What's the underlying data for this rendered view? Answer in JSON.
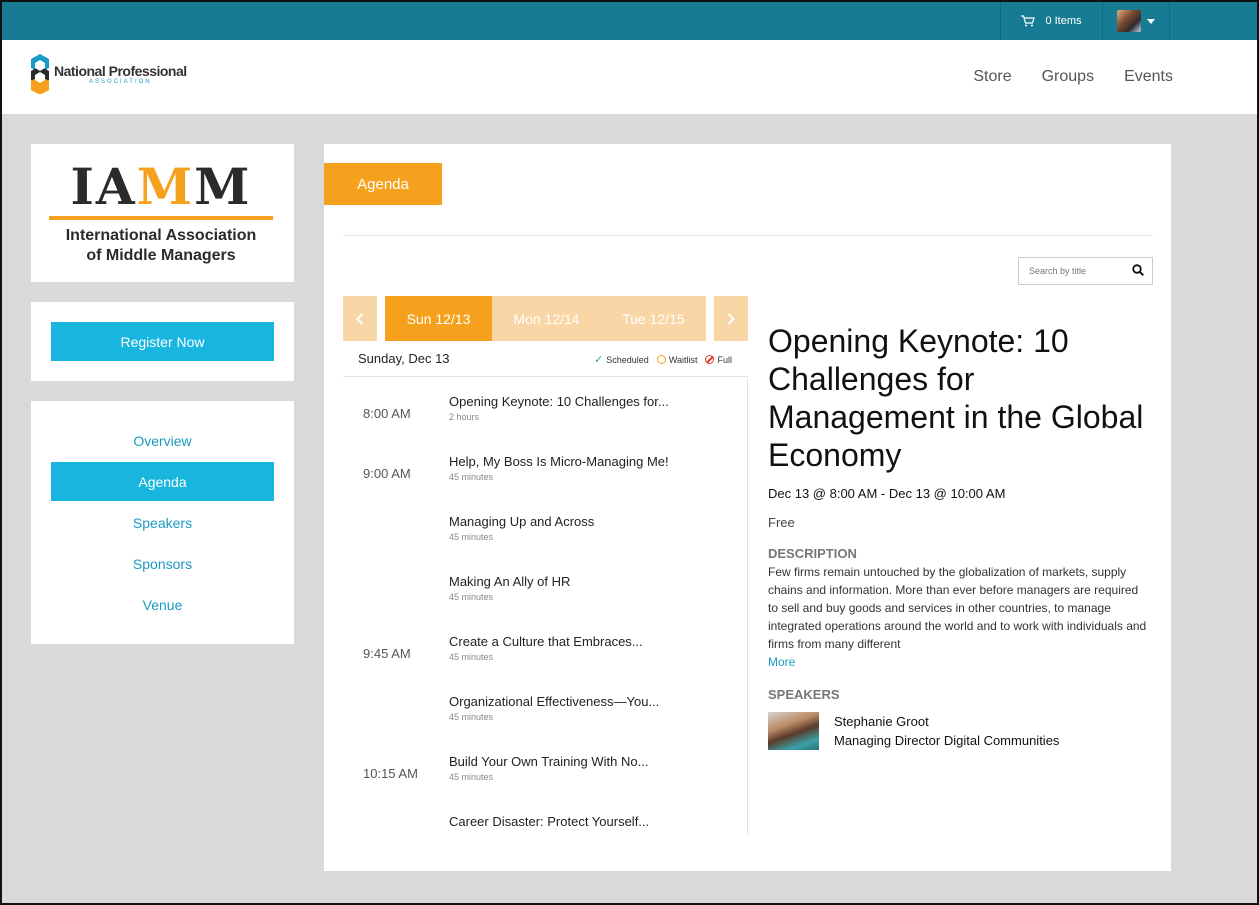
{
  "topbar": {
    "cart_label": "0 Items"
  },
  "header": {
    "brand_title": "National Professional",
    "brand_sub": "ASSOCIATION",
    "nav": [
      "Store",
      "Groups",
      "Events"
    ]
  },
  "org": {
    "acronym_1": "IA",
    "acronym_2": "M",
    "acronym_3": "M",
    "name_line1": "International Association",
    "name_line2": "of Middle Managers"
  },
  "sidebar": {
    "register_label": "Register Now",
    "menu": [
      "Overview",
      "Agenda",
      "Speakers",
      "Sponsors",
      "Venue"
    ]
  },
  "main": {
    "tab_label": "Agenda",
    "search_placeholder": "Search by title",
    "days": [
      "Sun 12/13",
      "Mon 12/14",
      "Tue 12/15"
    ],
    "day_title": "Sunday, Dec 13",
    "legend": {
      "scheduled": "Scheduled",
      "waitlist": "Waitlist",
      "full": "Full"
    },
    "sessions": [
      {
        "time": "8:00 AM",
        "title": "Opening Keynote: 10 Challenges for...",
        "duration": "2 hours"
      },
      {
        "time": "9:00 AM",
        "title": "Help, My Boss Is Micro-Managing Me!",
        "duration": "45 minutes"
      },
      {
        "time": "",
        "title": "Managing Up and Across",
        "duration": "45 minutes"
      },
      {
        "time": "",
        "title": "Making An Ally of HR",
        "duration": "45 minutes"
      },
      {
        "time": "9:45 AM",
        "title": "Create a Culture that Embraces...",
        "duration": "45 minutes"
      },
      {
        "time": "",
        "title": "Organizational Effectiveness—You...",
        "duration": "45 minutes"
      },
      {
        "time": "10:15 AM",
        "title": "Build Your Own Training With No...",
        "duration": "45 minutes"
      },
      {
        "time": "",
        "title": "Career Disaster: Protect Yourself...",
        "duration": ""
      }
    ]
  },
  "detail": {
    "title": "Opening Keynote: 10 Challenges for Management in the Global Economy",
    "when": "Dec 13 @ 8:00 AM - Dec 13 @ 10:00 AM",
    "price": "Free",
    "description_label": "DESCRIPTION",
    "description": "Few firms remain untouched by the globalization of markets, supply chains and information. More than ever before managers are required to sell and buy goods and services in other countries, to manage integrated operations around the world and to work with individuals and firms from many different",
    "more_label": "More",
    "speakers_label": "SPEAKERS",
    "speaker_name": "Stephanie Groot",
    "speaker_role": "Managing Director Digital Communities"
  },
  "colors": {
    "topbar": "#177b93",
    "accent_orange": "#f5a11d",
    "accent_blue": "#18b5df",
    "link_blue": "#1a9bc4"
  }
}
